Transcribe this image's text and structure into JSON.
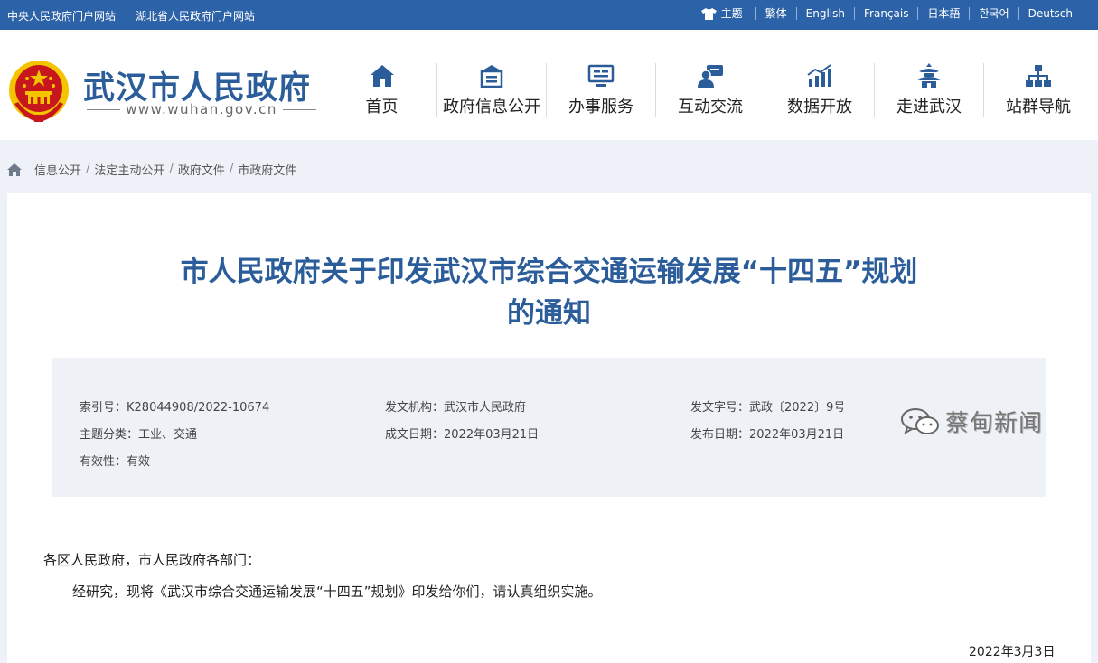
{
  "topbar": {
    "links": [
      "中央人民政府门户网站",
      "湖北省人民政府门户网站"
    ],
    "theme_label": "主题",
    "languages": [
      "繁体",
      "English",
      "Français",
      "日本語",
      "한국어",
      "Deutsch"
    ]
  },
  "header": {
    "site_title": "武汉市人民政府",
    "site_url": "www.wuhan.gov.cn",
    "nav": [
      {
        "label": "首页",
        "icon": "home-icon"
      },
      {
        "label": "政府信息公开",
        "icon": "building-icon"
      },
      {
        "label": "办事服务",
        "icon": "monitor-icon"
      },
      {
        "label": "互动交流",
        "icon": "chat-user-icon"
      },
      {
        "label": "数据开放",
        "icon": "bar-chart-icon"
      },
      {
        "label": "走进武汉",
        "icon": "pagoda-icon"
      },
      {
        "label": "站群导航",
        "icon": "sitemap-icon"
      }
    ]
  },
  "breadcrumb": [
    "信息公开",
    "法定主动公开",
    "政府文件",
    "市政府文件"
  ],
  "document": {
    "title_line1": "市人民政府关于印发武汉市综合交通运输发展“十四五”规划",
    "title_line2": "的通知",
    "meta": {
      "index_no_label": "索引号：",
      "index_no": "K28044908/2022-10674",
      "issuer_label": "发文机构：",
      "issuer": "武汉市人民政府",
      "doc_no_label": "发文字号：",
      "doc_no": "武政〔2022〕9号",
      "topic_label": "主题分类：",
      "topic": "工业、交通",
      "created_label": "成文日期：",
      "created": "2022年03月21日",
      "published_label": "发布日期：",
      "published": "2022年03月21日",
      "validity": "有效性：有效"
    },
    "salutation": "各区人民政府，市人民政府各部门：",
    "paragraph": "经研究，现将《武汉市综合交通运输发展“十四五”规划》印发给你们，请认真组织实施。",
    "date": "2022年3月3日"
  },
  "watermark": {
    "text": "蔡甸新闻"
  },
  "colors": {
    "brand_blue": "#2c63a8",
    "title_blue": "#2c5d9b",
    "emblem_red": "#c8161d",
    "emblem_gold": "#f5c400"
  }
}
